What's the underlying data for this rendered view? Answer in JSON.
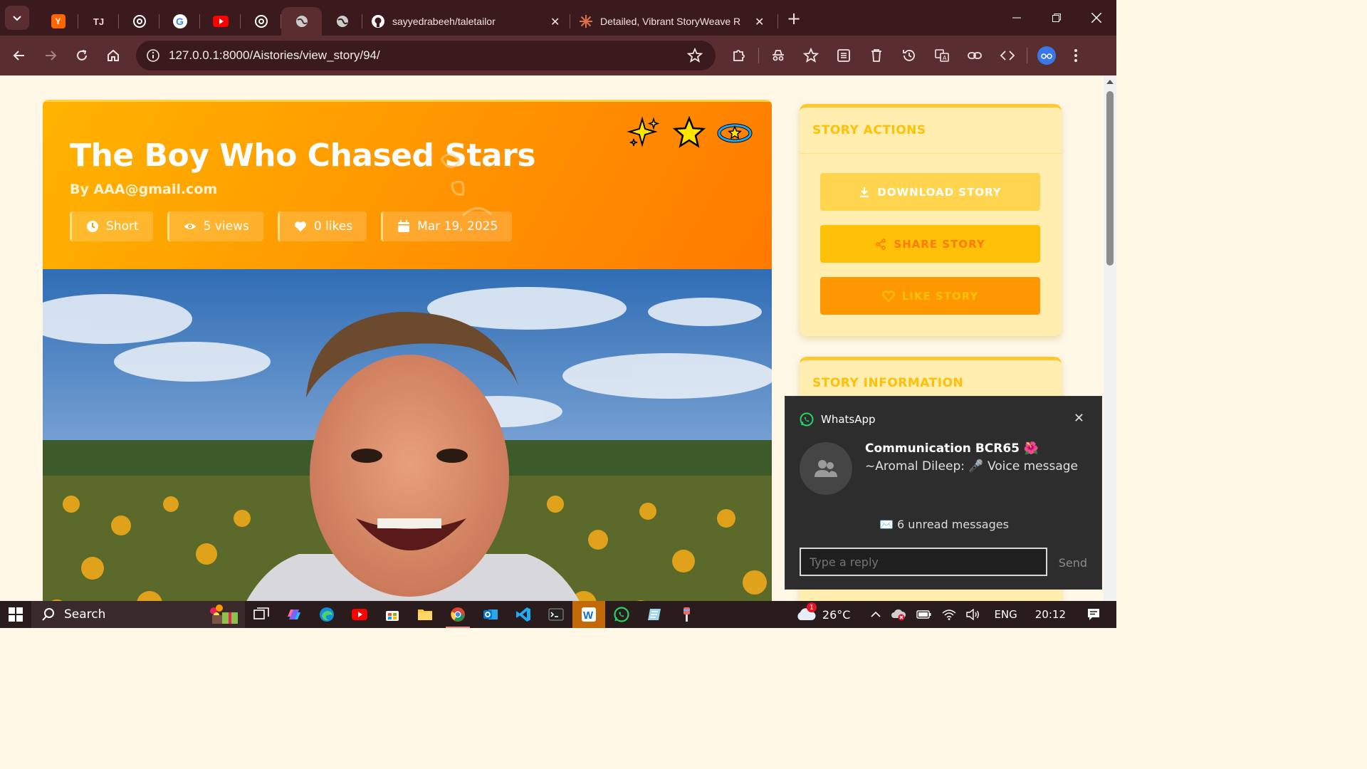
{
  "browser": {
    "tabs": [
      {
        "icon": "y-combinator-icon",
        "glyph": "Y",
        "color": "#ff6600"
      },
      {
        "icon": "tj-icon",
        "glyph": "TJ",
        "color": "#3a1a1c"
      },
      {
        "icon": "chatgpt-icon",
        "glyph": "",
        "color": "#3a1a1c"
      },
      {
        "icon": "google-icon",
        "glyph": "G",
        "color": "#3a1a1c"
      },
      {
        "icon": "youtube-icon",
        "glyph": "",
        "color": "#ff0000"
      },
      {
        "icon": "chatgpt-icon",
        "glyph": "",
        "color": "#3a1a1c"
      },
      {
        "icon": "globe-icon",
        "glyph": "",
        "color": "#3a1a1c",
        "active": true
      },
      {
        "icon": "globe-icon",
        "glyph": "",
        "color": "#3a1a1c"
      }
    ],
    "tab_github": {
      "title": "sayyedrabeeh/taletailor",
      "close": "✕"
    },
    "tab_claude": {
      "title": "Detailed, Vibrant StoryWeave R",
      "close": "✕"
    },
    "new_tab": "+",
    "url": "127.0.0.1:8000/Aistories/view_story/94/"
  },
  "story": {
    "title": "The Boy Who Chased Stars",
    "author": "By AAA@gmail.com",
    "chips": [
      {
        "icon": "clock-icon",
        "label": "Short"
      },
      {
        "icon": "eye-icon",
        "label": "5 views"
      },
      {
        "icon": "heart-icon",
        "label": "0 likes"
      },
      {
        "icon": "calendar-icon",
        "label": "Mar 19, 2025"
      }
    ]
  },
  "actions": {
    "header": "STORY ACTIONS",
    "download": "DOWNLOAD STORY",
    "share": "SHARE STORY",
    "like": "LIKE STORY"
  },
  "info": {
    "header": "STORY INFORMATION"
  },
  "notification": {
    "app": "WhatsApp",
    "sender": "Communication BCR65 🌺",
    "message": "~Aromal Dileep: 🎤 Voice message",
    "unread": "✉️ 6 unread messages",
    "reply_placeholder": "Type a reply",
    "send": "Send"
  },
  "taskbar": {
    "search": "Search",
    "weather": "26°C",
    "weather_badge": "1",
    "language": "ENG",
    "time": "20:12"
  },
  "colors": {
    "hero_start": "#ffb300",
    "hero_end": "#ff7a00",
    "download_btn": "#ffd54f",
    "share_btn": "#ffc107",
    "like_btn": "#ff9800"
  }
}
